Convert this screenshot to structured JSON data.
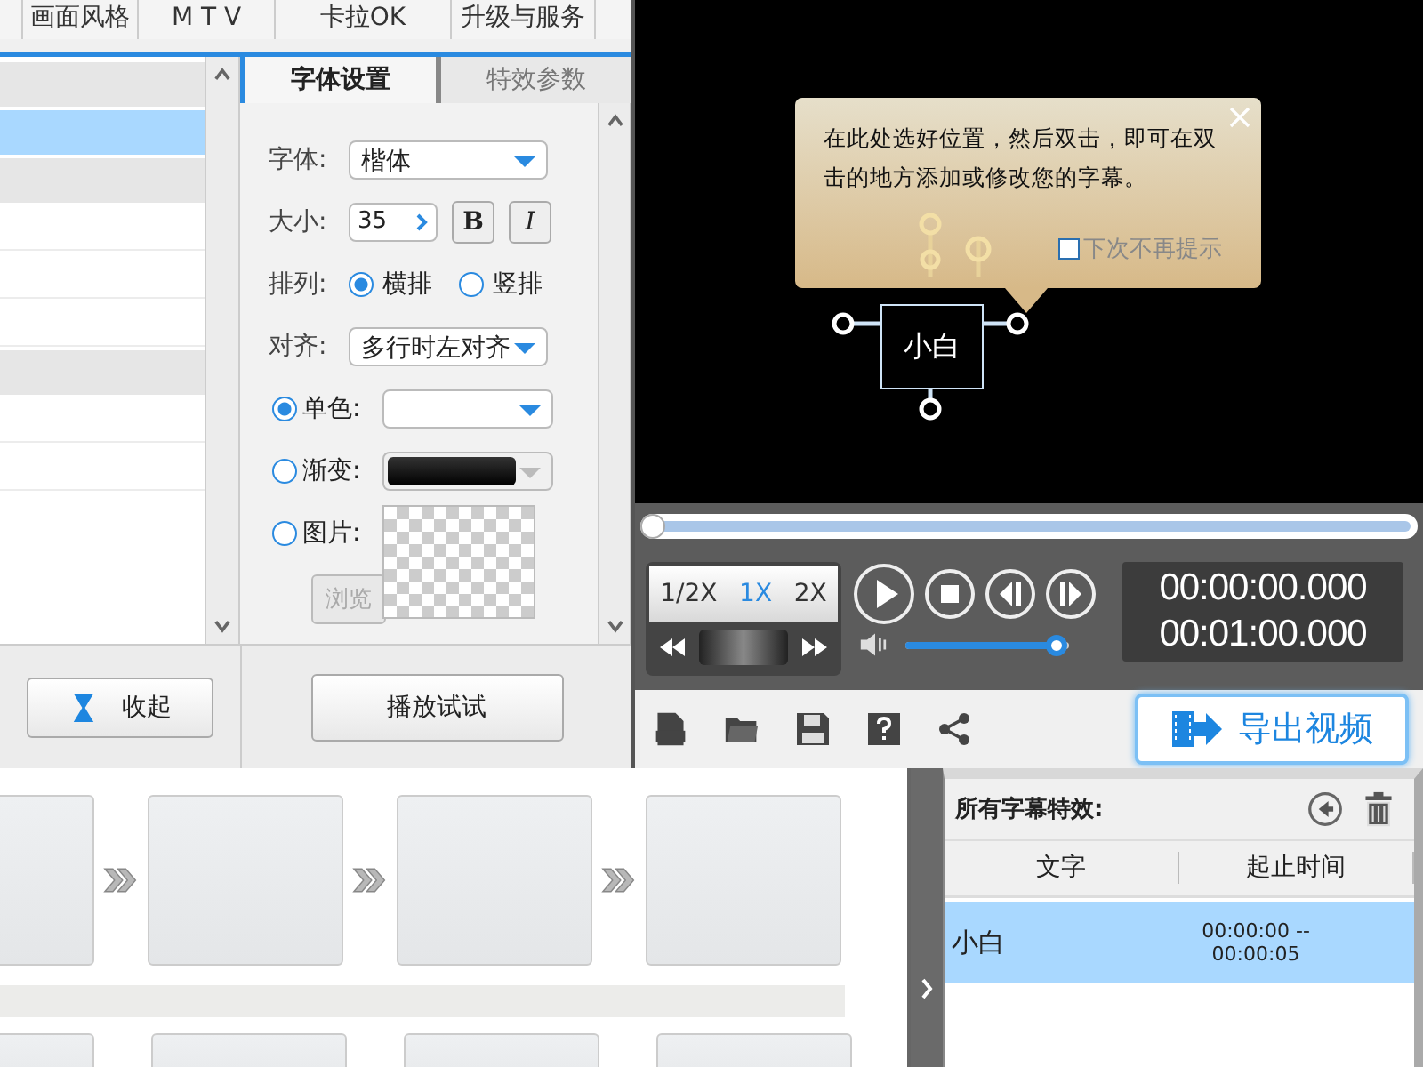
{
  "top_tabs": [
    {
      "label": "画面风格",
      "selected": false
    },
    {
      "label": "M T V",
      "selected": false
    },
    {
      "label": "卡拉OK",
      "selected": false
    },
    {
      "label": "升级与服务",
      "selected": false
    }
  ],
  "subtitle_list": {
    "rows": [
      {
        "selected": false,
        "shaded": true
      },
      {
        "selected": true,
        "shaded": false
      },
      {
        "selected": false,
        "shaded": true
      },
      {
        "selected": false,
        "shaded": false
      },
      {
        "selected": false,
        "shaded": false
      },
      {
        "selected": false,
        "shaded": false
      },
      {
        "selected": false,
        "shaded": true
      },
      {
        "selected": false,
        "shaded": false
      },
      {
        "selected": false,
        "shaded": false
      }
    ]
  },
  "font_panel": {
    "tabs": [
      {
        "label": "字体设置",
        "selected": true
      },
      {
        "label": "特效参数",
        "selected": false
      }
    ],
    "font": {
      "label": "字体:",
      "value": "楷体"
    },
    "size": {
      "label": "大小:",
      "value": "35"
    },
    "bold": {
      "label": "B",
      "on": false
    },
    "italic": {
      "label": "I",
      "on": false
    },
    "layout": {
      "label": "排列:",
      "options": [
        {
          "label": "横排",
          "selected": true
        },
        {
          "label": "竖排",
          "selected": false
        }
      ]
    },
    "align": {
      "label": "对齐:",
      "value": "多行时左对齐"
    },
    "fills": [
      {
        "kind": "solid",
        "label": "单色:",
        "selected": true
      },
      {
        "kind": "gradient",
        "label": "渐变:",
        "selected": false
      },
      {
        "kind": "image",
        "label": "图片:",
        "selected": false
      }
    ],
    "browse_button": {
      "label": "浏览",
      "disabled": true
    }
  },
  "collapse_button": "收起",
  "preview_button": "播放试试",
  "preview": {
    "tip": {
      "text": "在此处选好位置，然后双击，即可在双击的地方添加或修改您的字幕。",
      "checkbox": {
        "label": "下次不再提示",
        "checked": false
      }
    },
    "subtitle_box": "小白"
  },
  "playback": {
    "progress": {
      "level": 0
    },
    "speeds": [
      {
        "label": "1/2X",
        "selected": false
      },
      {
        "label": "1X",
        "selected": true
      },
      {
        "label": "2X",
        "selected": false
      }
    ],
    "current_time": "00:00:00.000",
    "total_time": "00:01:00.000",
    "volume": {
      "level": 0.92
    }
  },
  "export_button": "导出视频",
  "effects_panel": {
    "title": "所有字幕特效:",
    "columns": [
      "文字",
      "起止时间"
    ],
    "rows": [
      {
        "text": "小白",
        "time": "00:00:00 -- 00:00:05",
        "selected": true
      }
    ]
  }
}
